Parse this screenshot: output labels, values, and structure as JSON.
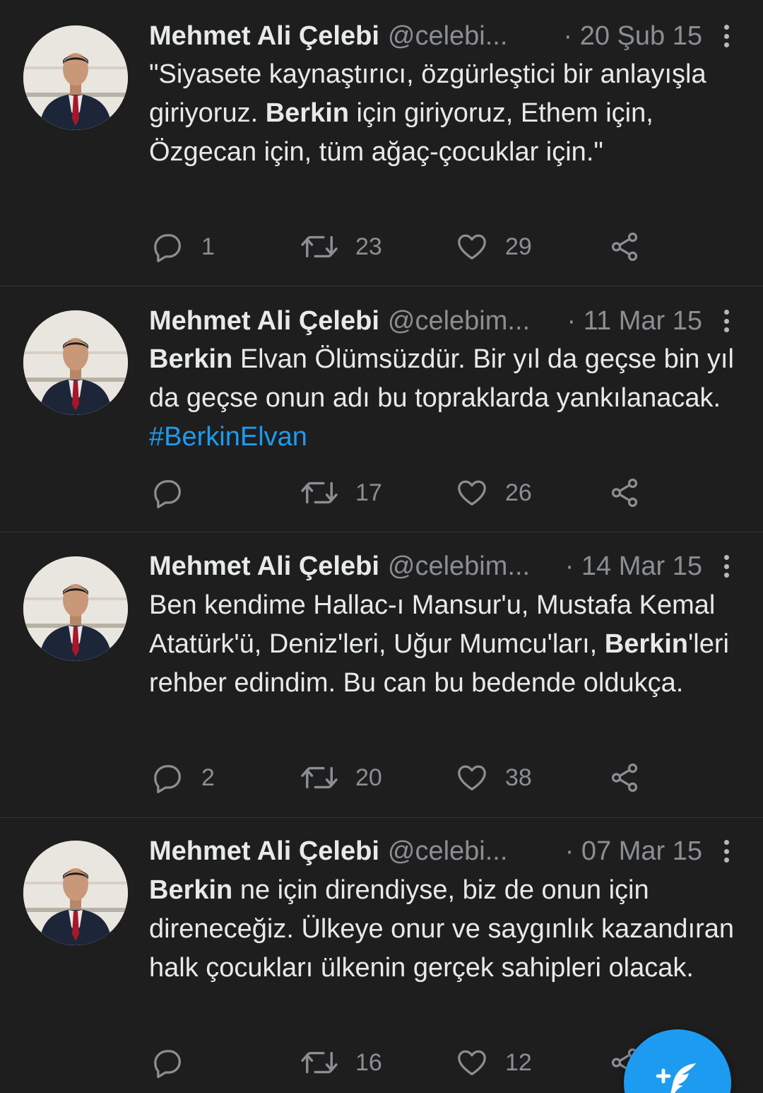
{
  "colors": {
    "background": "#1e1e1e",
    "text": "#e7e9ea",
    "secondary": "#8b8f93",
    "accent": "#1d9bf0",
    "divider": "#353535"
  },
  "icons": {
    "reply": "reply-bubble-icon",
    "retweet": "retweet-arrows-icon",
    "like": "heart-icon",
    "share": "share-icon",
    "more": "more-vertical-icon",
    "compose": "compose-feather-icon"
  },
  "tweets": [
    {
      "name": "Mehmet Ali Çelebi",
      "handle": "@celebi...",
      "date": "· 20 Şub 15",
      "text": [
        {
          "t": "\"Siyasete kaynaştırıcı, özgürleştici bir anlayışla giriyoruz. "
        },
        {
          "t": "Berkin",
          "style": "bold"
        },
        {
          "t": " için giriyoruz, Ethem için, Özgecan için, tüm ağaç-çocuklar için.\""
        }
      ],
      "replies": "1",
      "retweets": "23",
      "likes": "29"
    },
    {
      "name": "Mehmet Ali Çelebi",
      "handle": "@celebim...",
      "date": "· 11 Mar 15",
      "text": [
        {
          "t": "Berkin",
          "style": "bold"
        },
        {
          "t": " Elvan Ölümsüzdür. Bir yıl da geçse bin yıl da geçse onun adı bu topraklarda yankılanacak. "
        },
        {
          "t": "#BerkinElvan",
          "style": "hashtag"
        }
      ],
      "replies": "",
      "retweets": "17",
      "likes": "26"
    },
    {
      "name": "Mehmet Ali Çelebi",
      "handle": "@celebim...",
      "date": "· 14 Mar 15",
      "text": [
        {
          "t": "Ben kendime Hallac-ı Mansur'u, Mustafa Kemal Atatürk'ü, Deniz'leri, Uğur Mumcu'ları, "
        },
        {
          "t": "Berkin",
          "style": "bold"
        },
        {
          "t": "'leri rehber edindim. Bu can bu bedende oldukça."
        }
      ],
      "replies": "2",
      "retweets": "20",
      "likes": "38"
    },
    {
      "name": "Mehmet Ali Çelebi",
      "handle": "@celebi...",
      "date": "· 07 Mar 15",
      "text": [
        {
          "t": "Berkin",
          "style": "bold"
        },
        {
          "t": " ne için direndiyse, biz de onun için direneceğiz. Ülkeye onur ve saygınlık kazandıran halk çocukları ülkenin gerçek sahipleri olacak."
        }
      ],
      "replies": "",
      "retweets": "16",
      "likes": "12"
    }
  ]
}
